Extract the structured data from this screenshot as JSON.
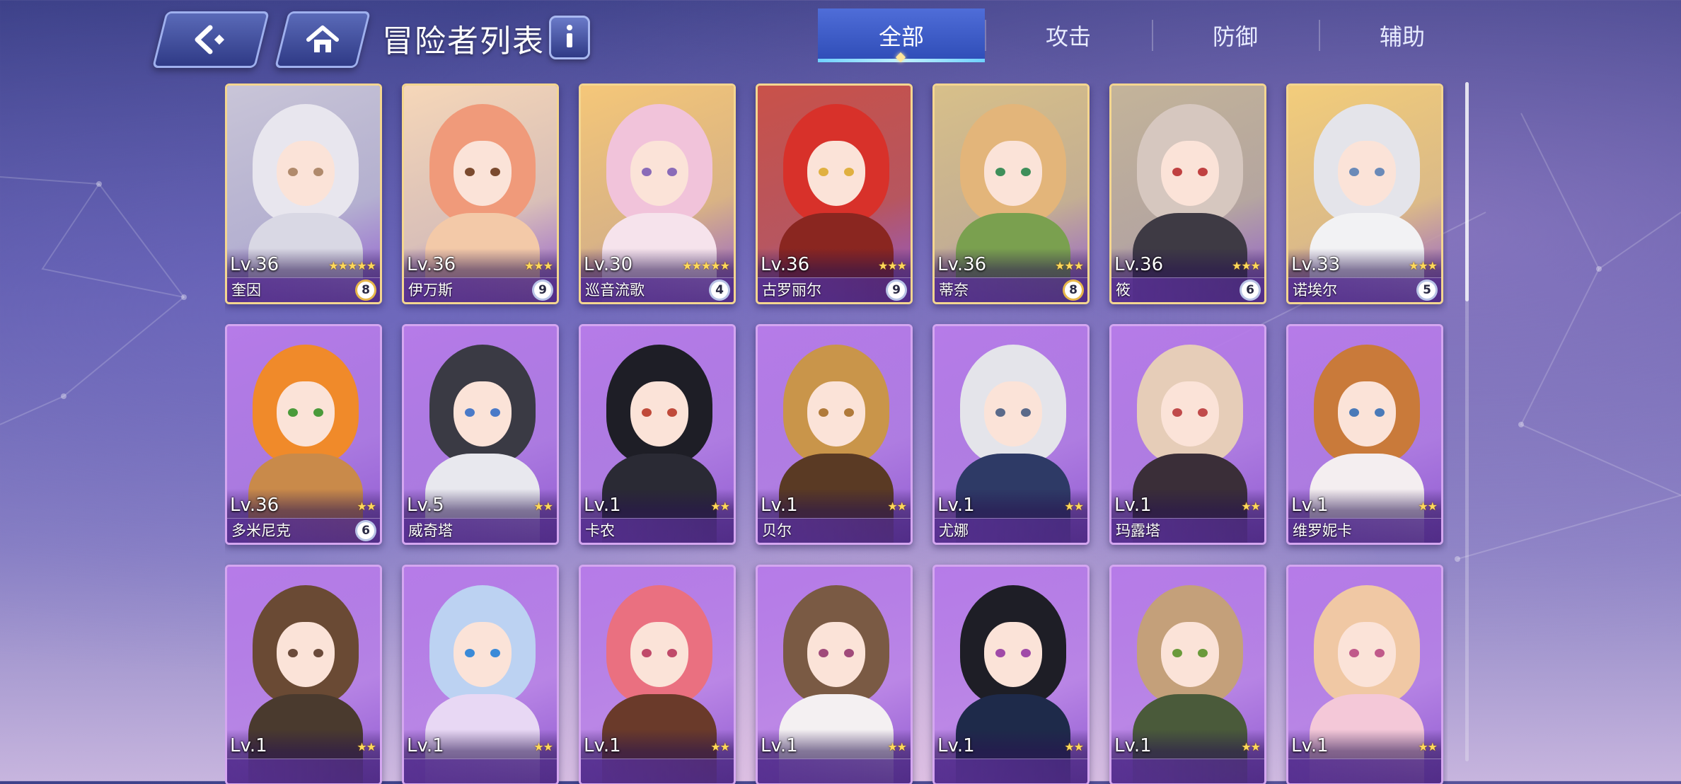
{
  "header": {
    "title": "冒险者列表",
    "back_icon": "back-arrow-icon",
    "home_icon": "home-icon",
    "info_icon": "info-icon"
  },
  "tabs": [
    {
      "label": "全部",
      "active": true
    },
    {
      "label": "攻击",
      "active": false
    },
    {
      "label": "防御",
      "active": false
    },
    {
      "label": "辅助",
      "active": false
    }
  ],
  "adventurers": [
    {
      "level": "Lv.36",
      "name": "奎因",
      "stars": 5,
      "badge": "8",
      "frame": "gold",
      "hair": "#e8e6ee",
      "body": "#d9d8e4",
      "bg": "#c9c5d8",
      "eye": "#b08a6c"
    },
    {
      "level": "Lv.36",
      "name": "伊万斯",
      "stars": 3,
      "badge": "9",
      "frame": "gold",
      "hair": "#f09a7a",
      "body": "#f3c9a8",
      "bg": "#f6d7b9",
      "eye": "#7b4a2e"
    },
    {
      "level": "Lv.30",
      "name": "巡音流歌",
      "stars": 5,
      "badge": "4",
      "frame": "gold",
      "hair": "#f1c3da",
      "body": "#f6e3ec",
      "bg": "#f5c779",
      "eye": "#8a6bb8"
    },
    {
      "level": "Lv.36",
      "name": "古罗丽尔",
      "stars": 3,
      "badge": "9",
      "frame": "gold",
      "hair": "#d8312a",
      "body": "#8a2620",
      "bg": "#c9524a",
      "eye": "#e0b040"
    },
    {
      "level": "Lv.36",
      "name": "蒂奈",
      "stars": 3,
      "badge": "8",
      "frame": "gold",
      "hair": "#e3b57a",
      "body": "#7aa04f",
      "bg": "#d8c08a",
      "eye": "#3f8f5a"
    },
    {
      "level": "Lv.36",
      "name": "筱",
      "stars": 3,
      "badge": "6",
      "frame": "gold",
      "hair": "#d6c7bf",
      "body": "#3e3a44",
      "bg": "#c4b49a",
      "eye": "#c04040"
    },
    {
      "level": "Lv.33",
      "name": "诺埃尔",
      "stars": 3,
      "badge": "5",
      "frame": "gold",
      "hair": "#e4e4ea",
      "body": "#f2f2f4",
      "bg": "#f3cd7b",
      "eye": "#6a8ab8"
    },
    {
      "level": "Lv.36",
      "name": "多米尼克",
      "stars": 2,
      "badge": "6",
      "frame": "purple",
      "hair": "#f08a2a",
      "body": "#c98a4a",
      "bg": "#b67be8",
      "eye": "#4a9a3a"
    },
    {
      "level": "Lv.5",
      "name": "威奇塔",
      "stars": 2,
      "badge": "",
      "frame": "purple",
      "hair": "#3a3a44",
      "body": "#e8e8ee",
      "bg": "#b67be8",
      "eye": "#4a7ac8"
    },
    {
      "level": "Lv.1",
      "name": "卡农",
      "stars": 2,
      "badge": "",
      "frame": "purple",
      "hair": "#1e1e26",
      "body": "#2a2a34",
      "bg": "#b67be8",
      "eye": "#c04a3a"
    },
    {
      "level": "Lv.1",
      "name": "贝尔",
      "stars": 2,
      "badge": "",
      "frame": "purple",
      "hair": "#c9954a",
      "body": "#5a3a24",
      "bg": "#b67be8",
      "eye": "#b07a3a"
    },
    {
      "level": "Lv.1",
      "name": "尤娜",
      "stars": 2,
      "badge": "",
      "frame": "purple",
      "hair": "#e4e4ea",
      "body": "#2e3a66",
      "bg": "#b67be8",
      "eye": "#5a6a8a"
    },
    {
      "level": "Lv.1",
      "name": "玛露塔",
      "stars": 2,
      "badge": "",
      "frame": "purple",
      "hair": "#e6cdb8",
      "body": "#3a2e38",
      "bg": "#b67be8",
      "eye": "#c04a4a"
    },
    {
      "level": "Lv.1",
      "name": "维罗妮卡",
      "stars": 2,
      "badge": "",
      "frame": "purple",
      "hair": "#c97a3a",
      "body": "#f4eef0",
      "bg": "#b67be8",
      "eye": "#4a7ab8"
    },
    {
      "level": "Lv.1",
      "name": "",
      "stars": 2,
      "badge": "",
      "frame": "purple",
      "hair": "#6a4a34",
      "body": "#4a3a2e",
      "bg": "#b67be8",
      "eye": "#6a4a3a"
    },
    {
      "level": "Lv.1",
      "name": "",
      "stars": 2,
      "badge": "",
      "frame": "purple",
      "hair": "#bcd2f2",
      "body": "#e8d8f4",
      "bg": "#b67be8",
      "eye": "#3a8ad8"
    },
    {
      "level": "Lv.1",
      "name": "",
      "stars": 2,
      "badge": "",
      "frame": "purple",
      "hair": "#ea7080",
      "body": "#6a3a2a",
      "bg": "#b67be8",
      "eye": "#c04a6a"
    },
    {
      "level": "Lv.1",
      "name": "",
      "stars": 2,
      "badge": "",
      "frame": "purple",
      "hair": "#7a5a44",
      "body": "#f4f0f2",
      "bg": "#b67be8",
      "eye": "#a04a7a"
    },
    {
      "level": "Lv.1",
      "name": "",
      "stars": 2,
      "badge": "",
      "frame": "purple",
      "hair": "#1e1e26",
      "body": "#1e2a4a",
      "bg": "#b67be8",
      "eye": "#a04aa8"
    },
    {
      "level": "Lv.1",
      "name": "",
      "stars": 2,
      "badge": "",
      "frame": "purple",
      "hair": "#c4a07a",
      "body": "#4a5a3a",
      "bg": "#b67be8",
      "eye": "#6a9a3a"
    },
    {
      "level": "Lv.1",
      "name": "",
      "stars": 2,
      "badge": "",
      "frame": "purple",
      "hair": "#f0c8a4",
      "body": "#f4c8d8",
      "bg": "#b67be8",
      "eye": "#c05a8a"
    }
  ]
}
